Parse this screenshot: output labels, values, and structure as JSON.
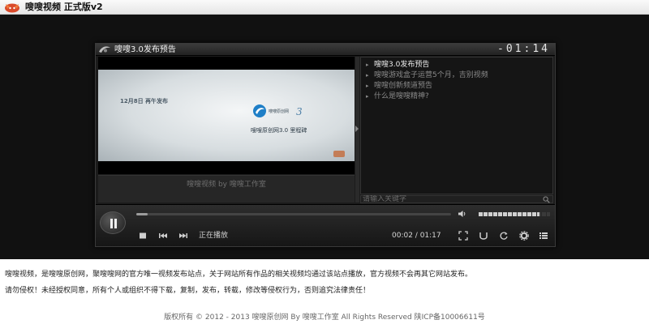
{
  "header": {
    "site_title": "嗖嗖视频  正式版v2",
    "logo_icon": "fox-logo-icon"
  },
  "player": {
    "video_title": "嗖嗖3.0发布预告",
    "clock": "-01:14",
    "frame": {
      "caption_left": "12月8日  再午发布",
      "badge_text": "嗖嗖原创网",
      "badge_number": "3",
      "caption_right": "嗖嗖原创网3.0 里程碑"
    },
    "studio_credit": "嗖嗖视频 by 嗖嗖工作室",
    "playlist": [
      {
        "label": "嗖嗖3.0发布预告",
        "active": true
      },
      {
        "label": "嗖嗖游戏盒子运营5个月，吉别视频",
        "active": false
      },
      {
        "label": "嗖嗖创新频道预告",
        "active": false
      },
      {
        "label": "什么是嗖嗖精神?",
        "active": false
      }
    ],
    "search": {
      "placeholder": "请输入关键字"
    },
    "controls": {
      "status": "正在播放",
      "time": "00:02 / 01:17",
      "progress_fraction": 0.035,
      "volume_fraction": 0.85
    },
    "colors": {
      "panel": "#1b1b1b",
      "stage": "#111111",
      "accent": "#c46a3a"
    }
  },
  "notice": {
    "line1": "嗖嗖视频，是嗖嗖原创网，聚嗖嗖网的官方唯一视频发布站点，关于网站所有作品的相关视频均通过该站点播放，官方视频不会再其它网站发布。",
    "line2": "请勿侵权！未经授权同意，所有个人或组织不得下载，复制，发布，转载，修改等侵权行为，否则追究法律责任！"
  },
  "footer": {
    "text": "版权所有 © 2012 - 2013 嗖嗖原创网 By 嗖嗖工作室 All Rights Reserved    陕ICP备10006611号"
  }
}
